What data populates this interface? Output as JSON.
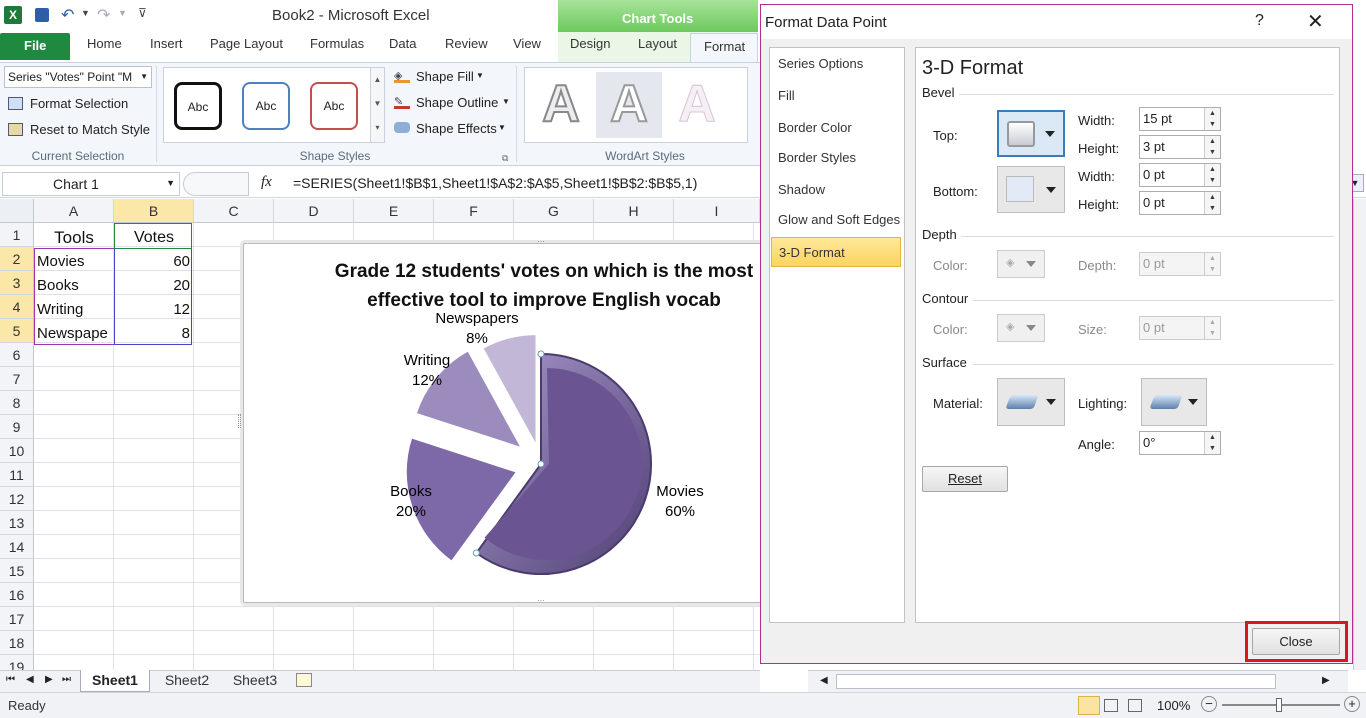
{
  "app": {
    "title": "Book2  -  Microsoft Excel",
    "chart_tools": "Chart Tools"
  },
  "ribbon": {
    "file": "File",
    "tabs": [
      "Home",
      "Insert",
      "Page Layout",
      "Formulas",
      "Data",
      "Review",
      "View",
      "Design",
      "Layout",
      "Format"
    ],
    "current_selection": {
      "dropdown": "Series \"Votes\" Point \"M",
      "format_selection": "Format Selection",
      "reset": "Reset to Match Style",
      "group": "Current Selection"
    },
    "shape_styles": {
      "abc": [
        "Abc",
        "Abc",
        "Abc"
      ],
      "fill": "Shape Fill",
      "outline": "Shape Outline",
      "effects": "Shape Effects",
      "group": "Shape Styles"
    },
    "wordart": {
      "letter": "A",
      "group": "WordArt Styles"
    }
  },
  "formula": {
    "name_box": "Chart 1",
    "fx": "fx",
    "formula": "=SERIES(Sheet1!$B$1,Sheet1!$A$2:$A$5,Sheet1!$B$2:$B$5,1)"
  },
  "grid": {
    "columns": [
      "A",
      "B",
      "C",
      "D",
      "E",
      "F",
      "G",
      "H",
      "I"
    ],
    "rows": [
      "1",
      "2",
      "3",
      "4",
      "5",
      "6",
      "7",
      "8",
      "9",
      "10",
      "11",
      "12",
      "13",
      "14",
      "15",
      "16",
      "17",
      "18",
      "19"
    ],
    "cells": [
      [
        "Tools",
        "Votes"
      ],
      [
        "Movies",
        "60"
      ],
      [
        "Books",
        "20"
      ],
      [
        "Writing",
        "12"
      ],
      [
        "Newspape",
        "8"
      ]
    ]
  },
  "chart_data": {
    "type": "pie",
    "title": "Grade 12 students' votes on which is the most effective tool to improve English vocab",
    "title_lines": [
      "Grade 12 students' votes on which is the most",
      "effective tool to improve English vocab"
    ],
    "categories": [
      "Movies",
      "Books",
      "Writing",
      "Newspapers"
    ],
    "values": [
      60,
      20,
      12,
      8
    ],
    "percent_labels": [
      "60%",
      "20%",
      "12%",
      "8%"
    ],
    "colors": [
      "#6a5592",
      "#7e69a8",
      "#9c8cbd",
      "#c2b7d6"
    ],
    "exploded": true
  },
  "sheets": {
    "tabs": [
      "Sheet1",
      "Sheet2",
      "Sheet3"
    ]
  },
  "status": {
    "ready": "Ready",
    "zoom": "100%"
  },
  "dialog": {
    "title": "Format Data Point",
    "help": "?",
    "nav": [
      "Series Options",
      "Fill",
      "Border Color",
      "Border Styles",
      "Shadow",
      "Glow and Soft Edges",
      "3-D Format"
    ],
    "heading": "3-D Format",
    "bevel": {
      "label": "Bevel",
      "top": "Top:",
      "bottom": "Bottom:",
      "width": "Width:",
      "height": "Height:",
      "top_width": "15 pt",
      "top_height": "3 pt",
      "bottom_width": "0 pt",
      "bottom_height": "0 pt"
    },
    "depth": {
      "label": "Depth",
      "color": "Color:",
      "depth": "Depth:",
      "value": "0 pt"
    },
    "contour": {
      "label": "Contour",
      "color": "Color:",
      "size": "Size:",
      "value": "0 pt"
    },
    "surface": {
      "label": "Surface",
      "material": "Material:",
      "lighting": "Lighting:",
      "angle": "Angle:",
      "angle_value": "0°"
    },
    "reset": "Reset",
    "close": "Close"
  }
}
